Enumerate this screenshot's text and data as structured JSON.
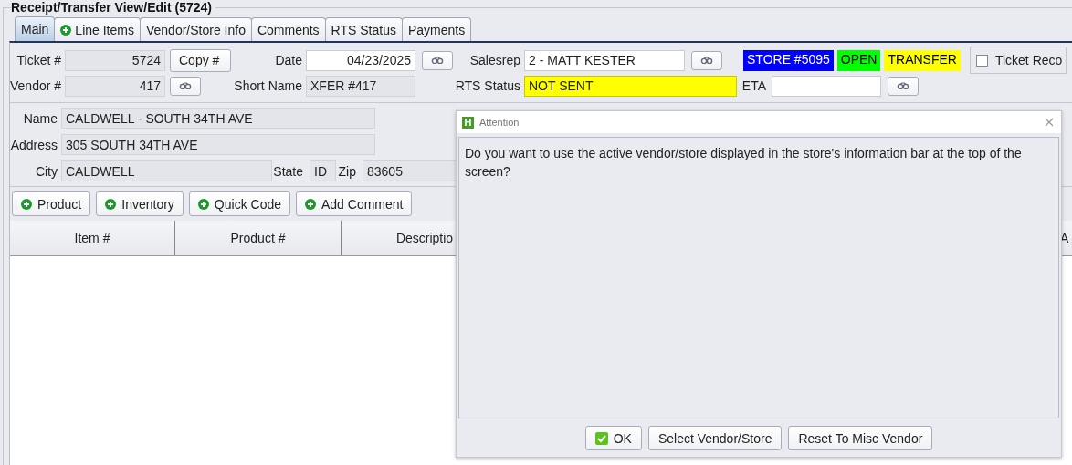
{
  "window": {
    "title": "Receipt/Transfer View/Edit  (5724)"
  },
  "tabs": [
    {
      "label": "Main",
      "selected": true,
      "add_icon": false
    },
    {
      "label": "Line Items",
      "selected": false,
      "add_icon": true
    },
    {
      "label": "Vendor/Store Info",
      "selected": false,
      "add_icon": false
    },
    {
      "label": "Comments",
      "selected": false,
      "add_icon": false
    },
    {
      "label": "RTS Status",
      "selected": false,
      "add_icon": false
    },
    {
      "label": "Payments",
      "selected": false,
      "add_icon": false
    }
  ],
  "header": {
    "ticket": {
      "label": "Ticket #",
      "value": "5724",
      "editable": false
    },
    "copy_button": "Copy #",
    "date": {
      "label": "Date",
      "value": "04/23/2025",
      "editable": true
    },
    "salesrep": {
      "label": "Salesrep",
      "value": "2 - MATT KESTER",
      "editable": true
    },
    "badges": [
      {
        "text": "STORE #5095",
        "color": "#0000ff"
      },
      {
        "text": "OPEN",
        "color": "#00ff00"
      },
      {
        "text": "TRANSFER",
        "color": "#ffff00"
      }
    ],
    "ticket_record": {
      "label": "Ticket Reco",
      "checked": false
    },
    "vendor": {
      "label": "Vendor #",
      "value": "417",
      "editable": false
    },
    "short_name": {
      "label": "Short Name",
      "value": "XFER #417",
      "editable": false
    },
    "rts_status": {
      "label": "RTS Status",
      "value": "NOT SENT",
      "highlighted": true
    },
    "eta": {
      "label": "ETA",
      "editable": true
    }
  },
  "address": {
    "name": {
      "label": "Name",
      "value": "CALDWELL - SOUTH 34TH AVE",
      "editable": false
    },
    "address": {
      "label": "Address",
      "value": "305 SOUTH 34TH AVE",
      "editable": false
    },
    "city": {
      "label": "City",
      "value": "CALDWELL",
      "editable": false
    },
    "state": {
      "label": "State",
      "value": "ID",
      "editable": false
    },
    "zip": {
      "label": "Zip",
      "value": "83605",
      "editable": false
    }
  },
  "action_buttons": [
    "Product",
    "Inventory",
    "Quick Code",
    "Add Comment"
  ],
  "table": {
    "columns": [
      "Item #",
      "Product #",
      "Descriptio",
      "A"
    ]
  },
  "dialog": {
    "title": "Attention",
    "icon_letter": "H",
    "message": "Do you want to use the active vendor/store displayed in the store's information bar at the top of the screen?",
    "buttons": [
      {
        "label": "OK",
        "kind": "confirm"
      },
      {
        "label": "Select Vendor/Store",
        "kind": "plain"
      },
      {
        "label": "Reset To Misc Vendor",
        "kind": "plain"
      }
    ]
  }
}
